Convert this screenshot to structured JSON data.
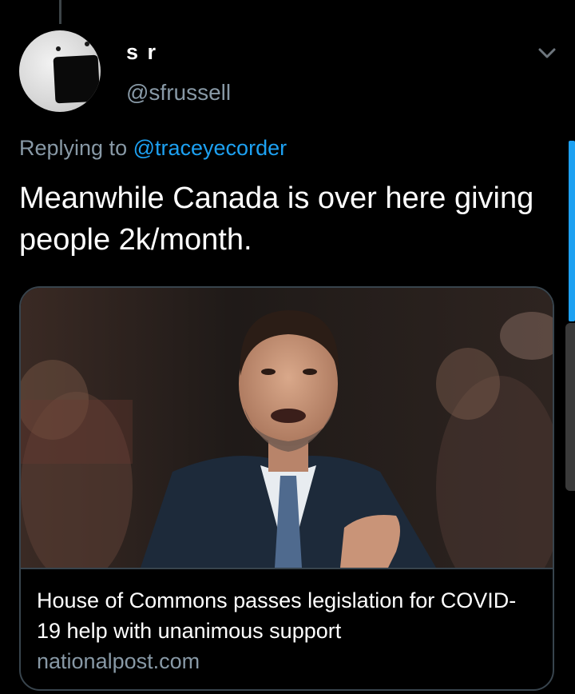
{
  "tweet": {
    "display_name": "s r",
    "handle": "@sfrussell",
    "replying_prefix": "Replying to",
    "replying_to": "@traceyecorder",
    "text": "Meanwhile Canada is over here giving people 2k/month."
  },
  "card": {
    "title": "House of Commons passes legislation for COVID-19 help with unanimous support",
    "domain": "nationalpost.com"
  },
  "icons": {
    "menu": "chevron-down-icon"
  },
  "colors": {
    "background": "#000000",
    "text_primary": "#ffffff",
    "text_secondary": "#8899a6",
    "link": "#1da1f2",
    "border": "#38444d"
  }
}
